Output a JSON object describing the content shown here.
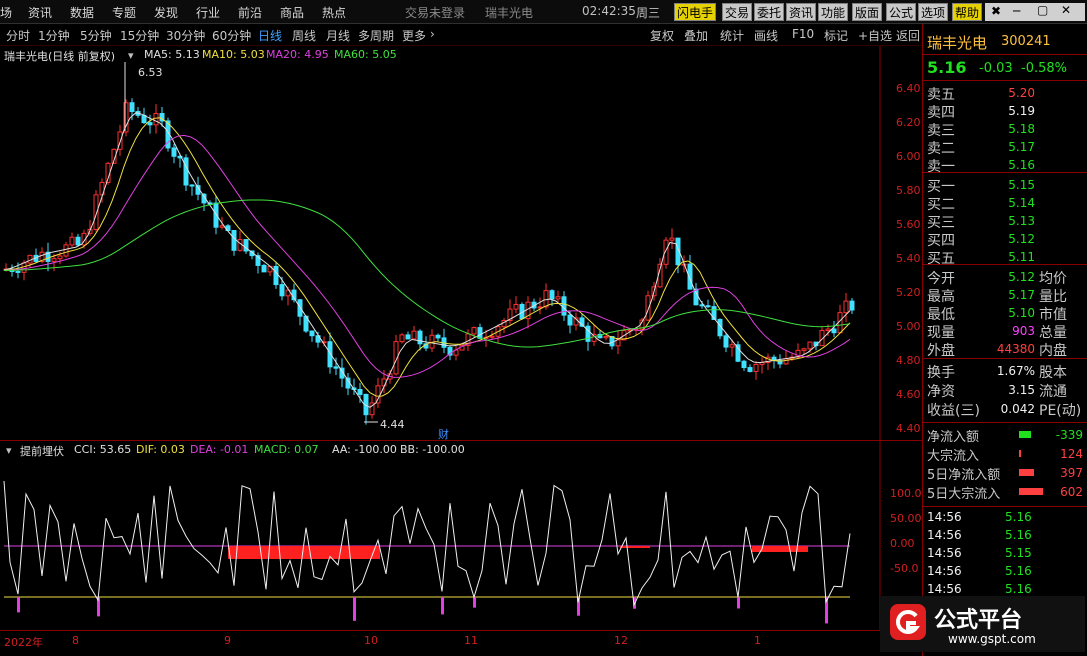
{
  "menu": [
    "场",
    "资讯",
    "数据",
    "专题",
    "发现",
    "行业",
    "前沿",
    "商品",
    "热点"
  ],
  "top_status": {
    "trade_login": "交易未登录",
    "stock_name": "瑞丰光电",
    "time": "02:42:35",
    "weekday": "周三"
  },
  "top_buttons": [
    "闪电手",
    "交易",
    "委托",
    "资讯",
    "功能",
    "版面",
    "公式",
    "选项",
    "帮助"
  ],
  "periods": [
    "分时",
    "1分钟",
    "5分钟",
    "15分钟",
    "30分钟",
    "60分钟",
    "日线",
    "周线",
    "月线",
    "多周期",
    "更多"
  ],
  "active_period": "日线",
  "tools": [
    "复权",
    "叠加",
    "统计",
    "画线",
    "F10",
    "标记",
    "+自选",
    "返回"
  ],
  "main_legend": {
    "title": "瑞丰光电(日线 前复权)",
    "ma5": "MA5: 5.13",
    "ma10": "MA10: 5.03",
    "ma20": "MA20: 4.95",
    "ma60": "MA60: 5.05"
  },
  "annotations": {
    "high": "6.53",
    "low": "4.44",
    "cai": "财"
  },
  "price_axis": [
    "6.40",
    "6.20",
    "6.00",
    "5.80",
    "5.60",
    "5.40",
    "5.20",
    "5.00",
    "4.80",
    "4.60",
    "4.40"
  ],
  "sub_legend": {
    "title": "提前埋伏",
    "cci": "CCI: 53.65",
    "dif": "DIF: 0.03",
    "dea": "DEA: -0.01",
    "macd": "MACD: 0.07",
    "aa": "AA: -100.00",
    "bb": "BB: -100.00"
  },
  "sub_axis": [
    "100.0",
    "50.00",
    "0.00",
    "-50.0"
  ],
  "time_axis": [
    "2022年",
    "8",
    "9",
    "10",
    "11",
    "12",
    "1"
  ],
  "quote": {
    "name": "瑞丰光电",
    "code": "300241",
    "price": "5.16",
    "change": "-0.03",
    "pct": "-0.58%",
    "asks": [
      {
        "label": "卖五",
        "price": "5.20"
      },
      {
        "label": "卖四",
        "price": "5.19"
      },
      {
        "label": "卖三",
        "price": "5.18"
      },
      {
        "label": "卖二",
        "price": "5.17"
      },
      {
        "label": "卖一",
        "price": "5.16"
      }
    ],
    "bids": [
      {
        "label": "买一",
        "price": "5.15"
      },
      {
        "label": "买二",
        "price": "5.14"
      },
      {
        "label": "买三",
        "price": "5.13"
      },
      {
        "label": "买四",
        "price": "5.12"
      },
      {
        "label": "买五",
        "price": "5.11"
      }
    ],
    "stats": [
      {
        "l1": "今开",
        "v1": "5.12",
        "l2": "均价"
      },
      {
        "l1": "最高",
        "v1": "5.17",
        "l2": "量比"
      },
      {
        "l1": "最低",
        "v1": "5.10",
        "l2": "市值"
      },
      {
        "l1": "现量",
        "v1": "903",
        "l2": "总量"
      },
      {
        "l1": "外盘",
        "v1": "44380",
        "l2": "内盘"
      }
    ],
    "stats2": [
      {
        "l1": "换手",
        "v1": "1.67%",
        "l2": "股本"
      },
      {
        "l1": "净资",
        "v1": "3.15",
        "l2": "流通"
      },
      {
        "l1": "收益(三)",
        "v1": "0.042",
        "l2": "PE(动)"
      }
    ],
    "flows": [
      {
        "label": "净流入额",
        "value": "-339",
        "color": "#20e020",
        "bar": 0.2
      },
      {
        "label": "大宗流入",
        "value": "124",
        "color": "#ff4040",
        "bar": 0.04
      },
      {
        "label": "5日净流入额",
        "value": "397",
        "color": "#ff4040",
        "bar": 0.25
      },
      {
        "label": "5日大宗流入",
        "value": "602",
        "color": "#ff4040",
        "bar": 0.4
      }
    ],
    "ticks": [
      {
        "time": "14:56",
        "price": "5.16"
      },
      {
        "time": "14:56",
        "price": "5.16"
      },
      {
        "time": "14:56",
        "price": "5.15"
      },
      {
        "time": "14:56",
        "price": "5.16"
      },
      {
        "time": "14:56",
        "price": "5.16"
      }
    ]
  },
  "watermark": "公式平台",
  "watermark_url": "www.gspt.com"
}
